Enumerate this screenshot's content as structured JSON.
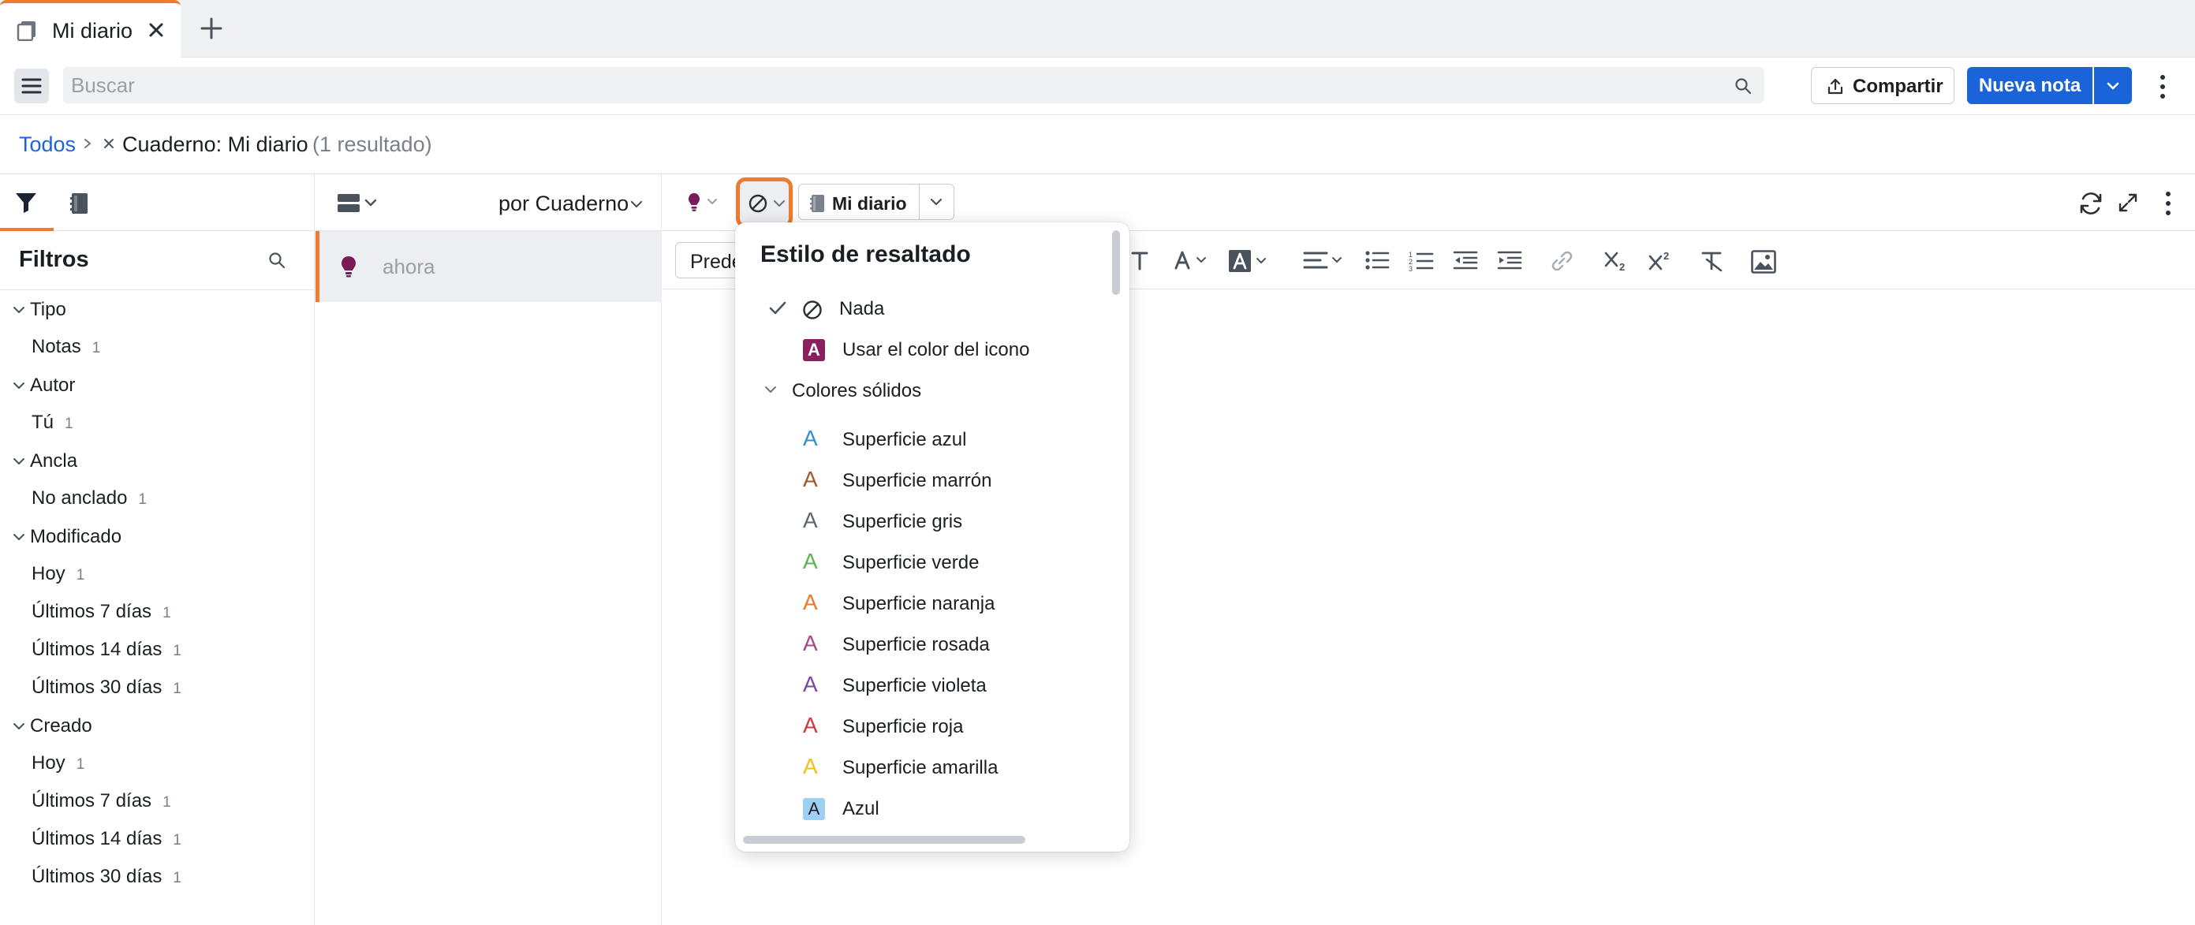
{
  "tab": {
    "title": "Mi diario"
  },
  "toolbar": {
    "search_placeholder": "Buscar",
    "share_label": "Compartir",
    "new_note_label": "Nueva nota"
  },
  "breadcrumb": {
    "all": "Todos",
    "notebook": "Cuaderno: Mi diario",
    "count": "(1 resultado)"
  },
  "filters": {
    "title": "Filtros",
    "groups": [
      {
        "label": "Tipo",
        "items": [
          {
            "label": "Notas",
            "count": "1"
          }
        ]
      },
      {
        "label": "Autor",
        "items": [
          {
            "label": "Tú",
            "count": "1"
          }
        ]
      },
      {
        "label": "Ancla",
        "items": [
          {
            "label": "No anclado",
            "count": "1"
          }
        ]
      },
      {
        "label": "Modificado",
        "items": [
          {
            "label": "Hoy",
            "count": "1"
          },
          {
            "label": "Últimos 7 días",
            "count": "1"
          },
          {
            "label": "Últimos 14 días",
            "count": "1"
          },
          {
            "label": "Últimos 30 días",
            "count": "1"
          }
        ]
      },
      {
        "label": "Creado",
        "items": [
          {
            "label": "Hoy",
            "count": "1"
          },
          {
            "label": "Últimos 7 días",
            "count": "1"
          },
          {
            "label": "Últimos 14 días",
            "count": "1"
          },
          {
            "label": "Últimos 30 días",
            "count": "1"
          }
        ]
      }
    ]
  },
  "list": {
    "sort_label": "por Cuaderno",
    "notes": [
      {
        "title": "ahora"
      }
    ]
  },
  "editor": {
    "notebook_label": "Mi diario",
    "style_select_value": "Predeterminado"
  },
  "highlight_menu": {
    "title": "Estilo de resaltado",
    "none_label": "Nada",
    "icon_color_label": "Usar el color del icono",
    "icon_color_chip": "A",
    "icon_color_hex": "#8a1f5e",
    "group_label": "Colores sólidos",
    "glyph": "A",
    "colors": [
      {
        "label": "Superficie azul",
        "color": "#2f8fd6"
      },
      {
        "label": "Superficie marrón",
        "color": "#a5572a"
      },
      {
        "label": "Superficie gris",
        "color": "#5c6670"
      },
      {
        "label": "Superficie verde",
        "color": "#56b847"
      },
      {
        "label": "Superficie naranja",
        "color": "#e67a2e"
      },
      {
        "label": "Superficie rosada",
        "color": "#b0428a"
      },
      {
        "label": "Superficie violeta",
        "color": "#7a45a8"
      },
      {
        "label": "Superficie roja",
        "color": "#d8343d"
      },
      {
        "label": "Superficie amarilla",
        "color": "#f2be23"
      }
    ],
    "azul": {
      "label": "Azul",
      "chip_bg": "#9fd0f2",
      "chip_fg": "#1b1f24"
    }
  },
  "colors": {
    "accent_orange": "#f07a2e",
    "primary_blue": "#1a63d9",
    "bulb_purple": "#7a1a58"
  }
}
